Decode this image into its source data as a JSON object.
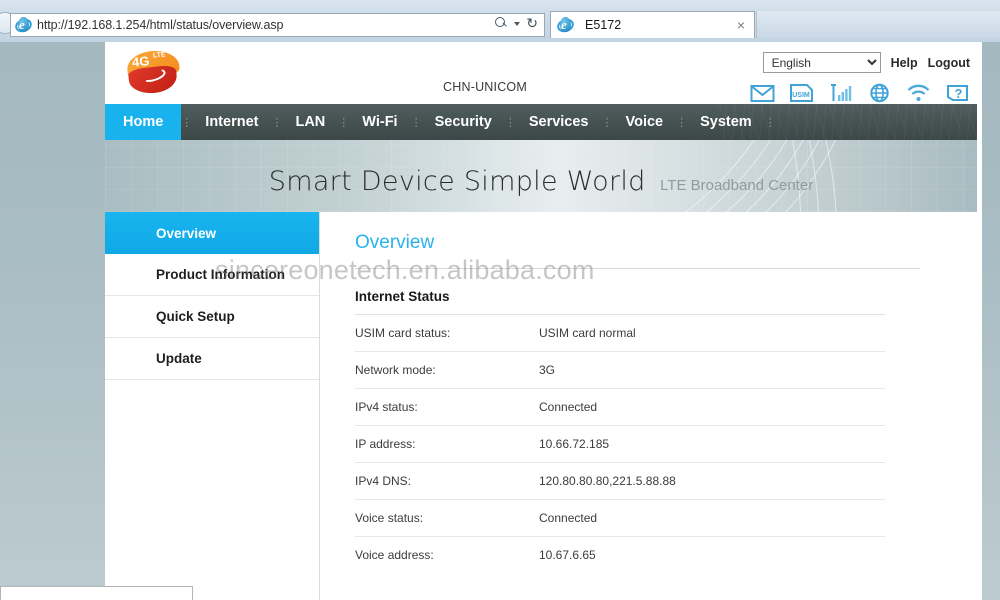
{
  "browser": {
    "url_prefix": "http://",
    "url_host": "192.168.1.254",
    "url_path": "/html/status/overview.asp",
    "url_full": "http://192.168.1.254/html/status/overview.asp",
    "tab_title": "E5172",
    "tab_close_label": "×",
    "refresh_label": "↻",
    "ie_logo_letter": "e"
  },
  "header": {
    "logo": {
      "primary": "4G",
      "secondary": "LTE"
    },
    "carrier": "CHN-UNICOM",
    "language_selected": "English",
    "language_options": [
      "English"
    ],
    "help_label": "Help",
    "logout_label": "Logout",
    "icons": [
      {
        "name": "mail-icon",
        "title": "Messages"
      },
      {
        "name": "usim-card-icon",
        "title": "USIM",
        "label": "USIM"
      },
      {
        "name": "signal-bars-icon",
        "title": "Signal"
      },
      {
        "name": "globe-icon",
        "title": "Network"
      },
      {
        "name": "wifi-icon",
        "title": "Wi-Fi"
      },
      {
        "name": "help-question-icon",
        "title": "Help",
        "label": "?"
      }
    ]
  },
  "nav": {
    "items": [
      {
        "label": "Home",
        "active": true
      },
      {
        "label": "Internet",
        "active": false
      },
      {
        "label": "LAN",
        "active": false
      },
      {
        "label": "Wi-Fi",
        "active": false
      },
      {
        "label": "Security",
        "active": false
      },
      {
        "label": "Services",
        "active": false
      },
      {
        "label": "Voice",
        "active": false
      },
      {
        "label": "System",
        "active": false
      }
    ],
    "separator": "⋮",
    "active_color": "#18b2ee"
  },
  "banner": {
    "headline": "Smart Device  Simple World",
    "subline": "LTE Broadband Center"
  },
  "sidebar": {
    "items": [
      {
        "label": "Overview",
        "active": true
      },
      {
        "label": "Product Information",
        "active": false
      },
      {
        "label": "Quick Setup",
        "active": false
      },
      {
        "label": "Update",
        "active": false
      }
    ]
  },
  "main": {
    "title": "Overview",
    "section_title": "Internet Status",
    "status_rows": [
      {
        "label": "USIM card status:",
        "value": "USIM card normal"
      },
      {
        "label": "Network mode:",
        "value": "3G"
      },
      {
        "label": "IPv4 status:",
        "value": "Connected"
      },
      {
        "label": "IP address:",
        "value": "10.66.72.185"
      },
      {
        "label": "IPv4 DNS:",
        "value": "120.80.80.80,221.5.88.88"
      },
      {
        "label": "Voice status:",
        "value": "Connected"
      },
      {
        "label": "Voice address:",
        "value": "10.67.6.65"
      }
    ]
  },
  "watermark": {
    "text": "sincereonetech.en.alibaba.com"
  },
  "colors": {
    "accent_cyan": "#18b2ee",
    "nav_dark": "#44514f",
    "page_bg": "#a9bcc2",
    "logo_orange": "#f59a23",
    "logo_red": "#d1271a"
  }
}
